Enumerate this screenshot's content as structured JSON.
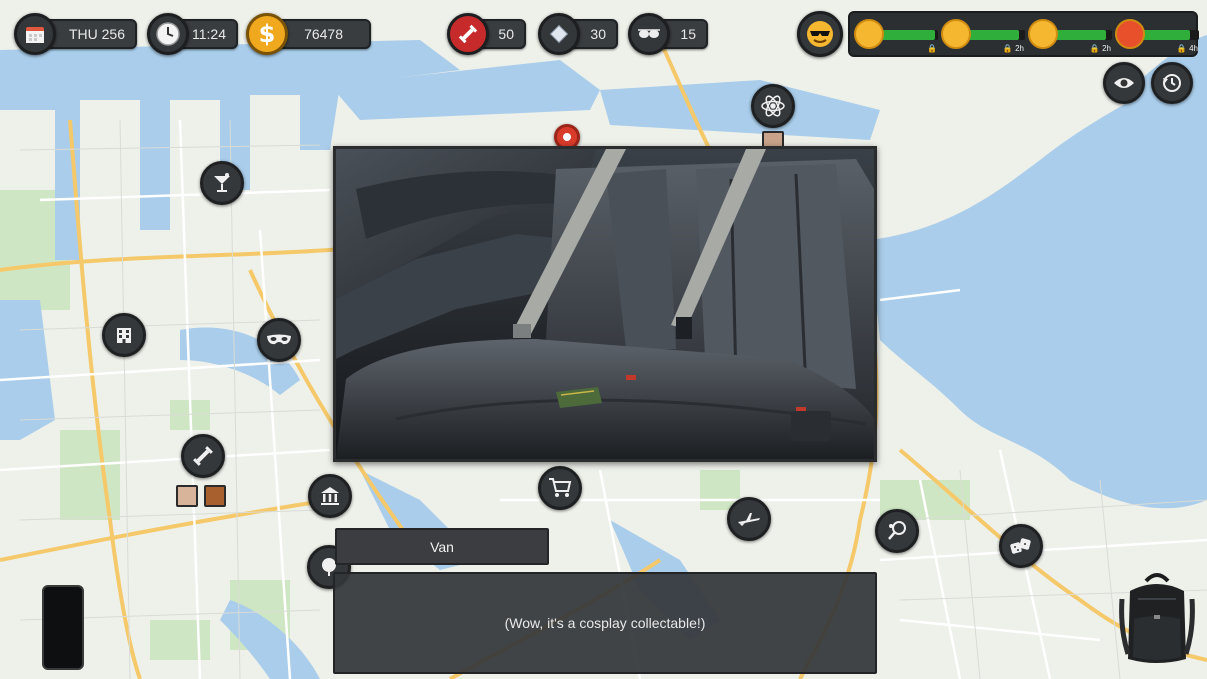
{
  "hud": {
    "day": "THU 256",
    "time": "11:24",
    "money": "76478",
    "stat_fitness": "50",
    "stat_charisma": "30",
    "stat_stealth": "15"
  },
  "moods": [
    {
      "icon": "sleepy-face-icon",
      "fill": 0.95,
      "timer": ""
    },
    {
      "icon": "hungry-face-icon",
      "fill": 0.9,
      "timer": "2h"
    },
    {
      "icon": "sick-face-icon",
      "fill": 0.9,
      "timer": "2h"
    },
    {
      "icon": "angry-face-icon",
      "fill": 0.85,
      "timer": "4h"
    }
  ],
  "dialogue": {
    "speaker": "Van",
    "text": "(Wow, it's a cosplay collectable!)"
  },
  "colors": {
    "hud_bg": "#3a3d40",
    "mood_bar": "#2fae3c",
    "gold": "#f5b730",
    "water": "#a9cdea",
    "land": "#eef0ea"
  }
}
